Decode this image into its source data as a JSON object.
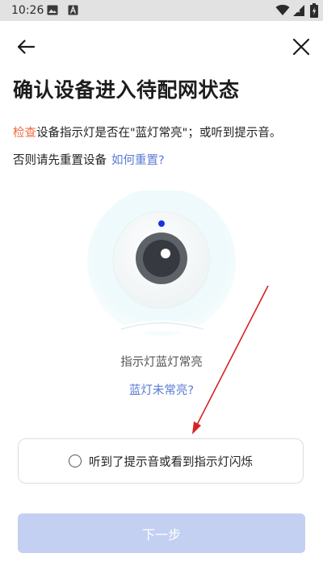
{
  "status_bar": {
    "time": "10:26",
    "icons": [
      "gallery-icon",
      "text-a-icon",
      "wifi-icon",
      "signal-icon",
      "battery-charging-icon"
    ]
  },
  "header": {
    "back_icon": "arrow-left-icon",
    "close_icon": "close-icon"
  },
  "title": "确认设备进入待配网状态",
  "instruction": {
    "highlight": "检查",
    "text": "设备指示灯是否在\"蓝灯常亮\"；或听到提示音。"
  },
  "reset": {
    "text": "否则请先重置设备",
    "link": "如何重置?"
  },
  "illustration": {
    "icon": "camera-icon",
    "caption": "指示灯蓝灯常亮",
    "link": "蓝灯未常亮?"
  },
  "confirm": {
    "label": "听到了提示音或看到指示灯闪烁",
    "checked": false
  },
  "next_button": {
    "label": "下一步",
    "enabled": false
  },
  "colors": {
    "accent_orange": "#f0693c",
    "link_blue": "#5b7bd5",
    "button_disabled": "#c3d0f1",
    "indicator_blue": "#1533e6",
    "annotation_red": "#d62222"
  }
}
